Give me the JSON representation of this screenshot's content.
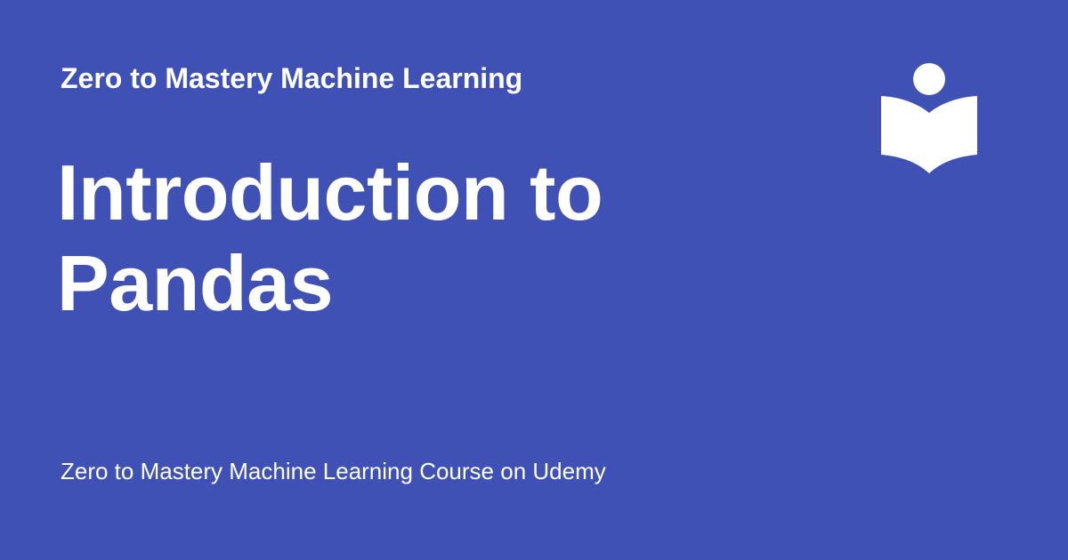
{
  "card": {
    "background_color": "#3f51b5",
    "text_color": "#ffffff",
    "site_name": "Zero to Mastery Machine Learning",
    "title": "Introduction to Pandas",
    "description": "Zero to Mastery Machine Learning Course on Udemy",
    "logo_icon": "reader-book-icon"
  }
}
